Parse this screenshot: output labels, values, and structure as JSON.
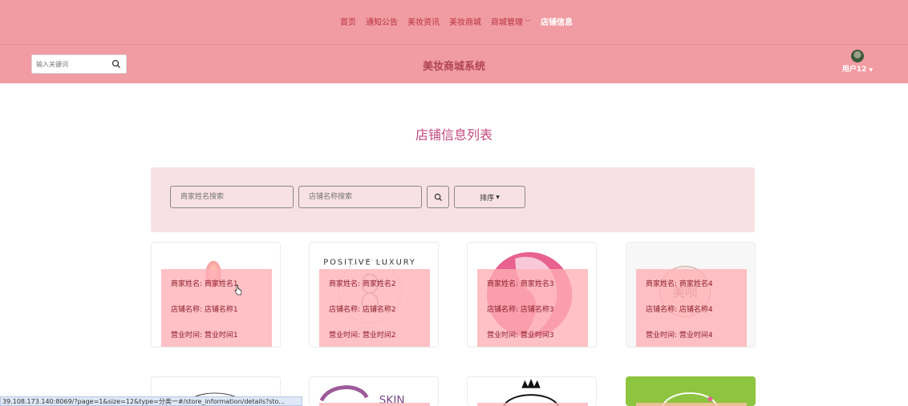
{
  "nav": {
    "items": [
      {
        "label": "首页"
      },
      {
        "label": "通知公告"
      },
      {
        "label": "美妆资讯"
      },
      {
        "label": "美妆商城"
      },
      {
        "label": "商城管理"
      },
      {
        "label": "店铺信息"
      }
    ],
    "dropdown_icon": "chevron-down-icon"
  },
  "header": {
    "search_placeholder": "输入关键词",
    "title": "美妆商城系统",
    "user_name": "用户12"
  },
  "page": {
    "title": "店铺信息列表"
  },
  "filters": {
    "merchant_name_placeholder": "商家姓名搜索",
    "store_name_placeholder": "店铺名称搜索",
    "sort_label": "排序"
  },
  "cards": [
    {
      "merchant": "商家姓名: 商家姓名1",
      "store": "店铺名称: 店铺名称1",
      "hours": "营业时间: 营业时间1"
    },
    {
      "merchant": "商家姓名: 商家姓名2",
      "store": "店铺名称: 店铺名称2",
      "hours": "营业时间: 营业时间2"
    },
    {
      "merchant": "商家姓名: 商家姓名3",
      "store": "店铺名称: 店铺名称3",
      "hours": "营业时间: 营业时间3"
    },
    {
      "merchant": "商家姓名: 商家姓名4",
      "store": "店铺名称: 店铺名称4",
      "hours": "营业时间: 营业时间4"
    }
  ],
  "card_images": {
    "card2_text": "POSITIVE LUXURY",
    "card4_text": "美呗",
    "card6_text": "SKIN"
  },
  "status_bar": {
    "url": "39.108.173.140:8069/?page=1&size=12&type=分类一#/store_information/details?sto..."
  },
  "colors": {
    "header_bg": "#f19ca2",
    "accent": "#c24a7e",
    "filter_bg": "#f8e1e4",
    "card_overlay": "#ffafb6"
  }
}
